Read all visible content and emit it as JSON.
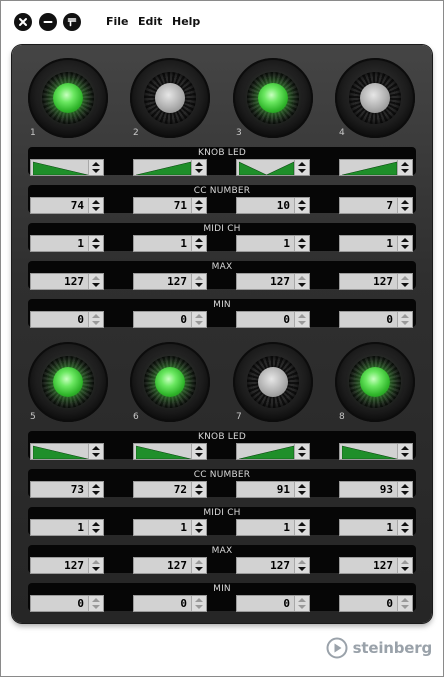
{
  "menu": {
    "file": "File",
    "edit": "Edit",
    "help": "Help"
  },
  "brand": {
    "logo_text": "steinberg"
  },
  "colors": {
    "led_on": "#3ccc36",
    "led_off": "#b0b0b0",
    "field_bg": "#d2d2d2"
  },
  "banks": [
    {
      "knobs": [
        {
          "number": "1",
          "led_on": true
        },
        {
          "number": "2",
          "led_on": false
        },
        {
          "number": "3",
          "led_on": true
        },
        {
          "number": "4",
          "led_on": false
        }
      ],
      "knob_led": {
        "label": "KNOB LED",
        "modes": [
          "ramp-down",
          "ramp-up",
          "v-shape",
          "ramp-up"
        ]
      },
      "cc_number": {
        "label": "CC NUMBER",
        "values": [
          "74",
          "71",
          "10",
          "7"
        ]
      },
      "midi_ch": {
        "label": "MIDI CH",
        "values": [
          "1",
          "1",
          "1",
          "1"
        ]
      },
      "max": {
        "label": "MAX",
        "values": [
          "127",
          "127",
          "127",
          "127"
        ]
      },
      "min": {
        "label": "MIN",
        "values": [
          "0",
          "0",
          "0",
          "0"
        ]
      }
    },
    {
      "knobs": [
        {
          "number": "5",
          "led_on": true
        },
        {
          "number": "6",
          "led_on": true
        },
        {
          "number": "7",
          "led_on": false
        },
        {
          "number": "8",
          "led_on": true
        }
      ],
      "knob_led": {
        "label": "KNOB LED",
        "modes": [
          "ramp-down",
          "ramp-down",
          "ramp-up",
          "ramp-down"
        ]
      },
      "cc_number": {
        "label": "CC NUMBER",
        "values": [
          "73",
          "72",
          "91",
          "93"
        ]
      },
      "midi_ch": {
        "label": "MIDI CH",
        "values": [
          "1",
          "1",
          "1",
          "1"
        ]
      },
      "max": {
        "label": "MAX",
        "values": [
          "127",
          "127",
          "127",
          "127"
        ]
      },
      "min": {
        "label": "MIN",
        "values": [
          "0",
          "0",
          "0",
          "0"
        ]
      }
    }
  ]
}
